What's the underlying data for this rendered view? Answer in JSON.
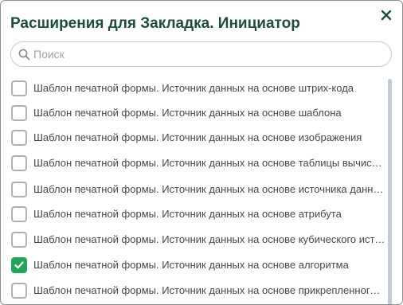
{
  "dialog": {
    "title": "Расширения для Закладка. Инициатор",
    "close_icon": "close-icon"
  },
  "search": {
    "placeholder": "Поиск",
    "value": "",
    "icon": "search-icon"
  },
  "colors": {
    "title": "#1e4d3a",
    "accent": "#22a55b",
    "checkbox_border": "#a9b1bb",
    "text": "#474747"
  },
  "items": [
    {
      "label": "Шаблон печатной формы. Источник данных на основе штрих-кода",
      "checked": false
    },
    {
      "label": "Шаблон печатной формы. Источник данных на основе шаблона",
      "checked": false
    },
    {
      "label": "Шаблон печатной формы. Источник данных на основе изображения",
      "checked": false
    },
    {
      "label": "Шаблон печатной формы. Источник данных на основе таблицы вычислений",
      "checked": false
    },
    {
      "label": "Шаблон печатной формы. Источник данных на основе источника данных",
      "checked": false
    },
    {
      "label": "Шаблон печатной формы. Источник данных на основе атрибута",
      "checked": false
    },
    {
      "label": "Шаблон печатной формы. Источник данных на основе кубического источника",
      "checked": false
    },
    {
      "label": "Шаблон печатной формы. Источник данных на основе алгоритма",
      "checked": true
    },
    {
      "label": "Шаблон печатной формы. Источник данных на основе прикрепленного файла",
      "checked": false
    }
  ]
}
